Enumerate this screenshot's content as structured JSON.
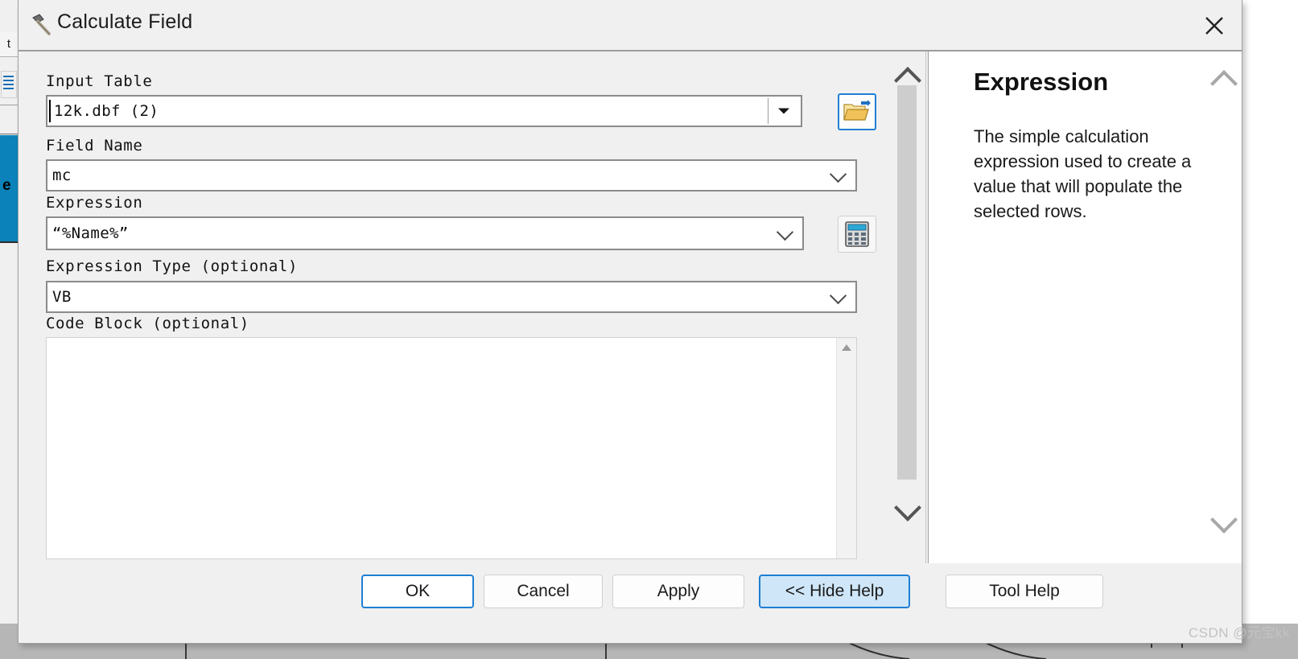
{
  "window": {
    "title": "Calculate Field",
    "icon": "hammer-icon",
    "close_label": "✕"
  },
  "form": {
    "fields": [
      {
        "label": "Input Table",
        "value": "12k.dbf (2)",
        "control": "combobox-with-browse",
        "browse_icon": "open-folder-icon"
      },
      {
        "label": "Field Name",
        "value": "mc",
        "control": "combobox"
      },
      {
        "label": "Expression",
        "value": "“%Name%”",
        "control": "combobox-with-builder",
        "builder_icon": "calculator-icon"
      },
      {
        "label": "Expression Type (optional)",
        "value": "VB",
        "control": "combobox"
      },
      {
        "label": "Code Block (optional)",
        "value": "",
        "control": "textarea"
      }
    ]
  },
  "help": {
    "title": "Expression",
    "text": "The simple calculation expression used to create a value that will populate the selected rows."
  },
  "footer": {
    "buttons": [
      {
        "label": "OK",
        "style": "primary"
      },
      {
        "label": "Cancel",
        "style": "normal"
      },
      {
        "label": "Apply",
        "style": "normal"
      },
      {
        "label": "<< Hide Help",
        "style": "accent"
      },
      {
        "label": "Tool Help",
        "style": "normal"
      }
    ]
  },
  "background": {
    "tab_label": "t",
    "selected_item_label": "e"
  },
  "watermark": "CSDN @元宝kk",
  "colors": {
    "accent_blue": "#1e7fd4",
    "accent_fill": "#cfe6f8",
    "dialog_bg": "#f0f0f0",
    "selection_blue": "#0b83ba"
  }
}
